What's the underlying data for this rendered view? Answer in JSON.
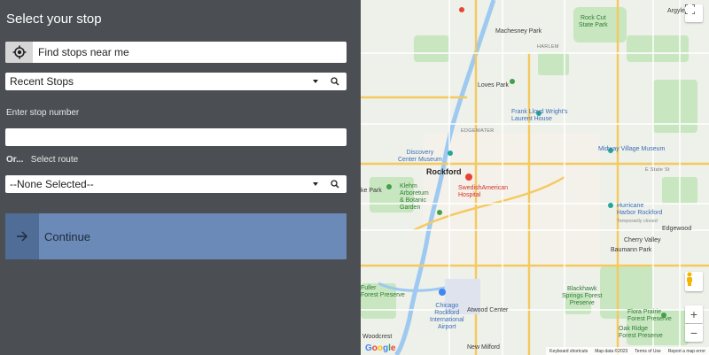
{
  "panel": {
    "title": "Select your stop",
    "find_button": "Find stops near me",
    "recent_stops": "Recent Stops",
    "stop_number_label": "Enter stop number",
    "stop_number_value": "",
    "or_label": "Or...",
    "route_label": "Select route",
    "route_select": "--None Selected--",
    "continue": "Continue"
  },
  "map": {
    "labels": {
      "machesney_park": "Machesney Park",
      "loves_park": "Loves Park",
      "rockford": "Rockford",
      "rock_cut": "Rock Cut\nState Park",
      "argyle": "Argyle",
      "flw": "Frank Lloyd Wright's\nLaurent House",
      "discovery": "Discovery\nCenter Museum",
      "swedish": "SwedishAmerican\nHospital",
      "midway": "Midway Village Museum",
      "klehm": "Klehm\nArboretum\n& Botanic\nGarden",
      "hurricane": "Hurricane\nHarbor Rockford",
      "temp_closed": "Temporarily closed",
      "edgewood": "Edgewood",
      "cherry_valley": "Cherry Valley",
      "baumann": "Baumann Park",
      "harlem": "HARLEM",
      "edgewater": "EDGEWATER",
      "e_state": "E State St",
      "ke_park": "ke Park",
      "fuller": "Fuller\nForest Preserve",
      "airport": "Chicago\nRockford\nInternational\nAirport",
      "atwood": "Atwood Center",
      "blackhawk": "Blackhawk\nSprings Forest\nPreserve",
      "flora": "Flora Prairie\nForest Preserve",
      "oak_ridge": "Oak Ridge\nForest Preserve",
      "woodcrest": "Woodcrest",
      "new_milford": "New Milford",
      "google": "Google"
    },
    "footer": {
      "shortcuts": "Keyboard shortcuts",
      "map_data": "Map data ©2023",
      "terms": "Terms of Use",
      "report": "Report a map error"
    },
    "zoom_in": "+",
    "zoom_out": "−"
  },
  "colors": {
    "panel_bg": "#4b4f54",
    "continue_bg": "#6b8ab7",
    "continue_icon_bg": "#4f6d96"
  }
}
